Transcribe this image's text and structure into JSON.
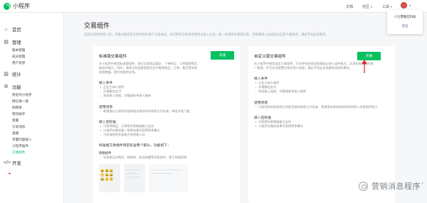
{
  "app": {
    "title": "小程序"
  },
  "topbar": {
    "links": [
      "文档",
      "社区",
      "工具"
    ],
    "account_name": "八九零微信科技",
    "logout_label": "退出"
  },
  "sidebar": {
    "groups": [
      {
        "icon": "home-icon",
        "label": "首页",
        "items": []
      },
      {
        "icon": "manage-icon",
        "label": "管理",
        "items": [
          "版本管理",
          "成员管理",
          "用户反馈"
        ]
      },
      {
        "icon": "stats-icon",
        "label": "统计",
        "items": []
      },
      {
        "icon": "feature-icon",
        "label": "功能",
        "items": [
          "附近的小程序",
          "微信搜一搜",
          "购物单",
          "物流助手",
          "客服",
          "订阅消息",
          "直播",
          "页面内容接入",
          "小程序插件",
          "交易组件"
        ]
      },
      {
        "icon": "dev-icon",
        "label": "开发",
        "items": []
      }
    ]
  },
  "main": {
    "title": "交易组件",
    "description": "当前交易组件接入后，可通过微信官方组件提升用户交易体验，也可参考交易组件使用与接入方式，统一的组件化管理方案，可按需接入标准版与自定义版组件，满足不同业务需求。"
  },
  "cards": {
    "standard": {
      "title": "标准版交易组件",
      "open_label": "开通",
      "description": "在小程序中使用标准版组件，即可实现商品展示、下单购买、订单管理等功能闭环能力，同时，商家可在配套管理后台中管理商品、订单、售后等交易流程数据，提升交易转化率。",
      "sections": [
        {
          "title": "接入条件",
          "items": [
            "企业主体小程序",
            "开通微信支付",
            "完成接入流程，详情请参考接入指南"
          ]
        },
        {
          "title": "适用场景",
          "items": [
            "希望通过小程序实现快速交易闭环的商家与开发者，降低开发门槛"
          ]
        },
        {
          "title": "接入后权益",
          "items": [
            "可获得商品、订单等交易数据能力支持",
            "小程序在微信搜一搜等场景可获得更多曝光",
            "可申请相关交易能力的快速入口"
          ]
        },
        {
          "title": "标准版交易组件目前包含两个部分，功能如下：",
          "items": []
        },
        {
          "title": "购物组件",
          "items": [
            "包括商品详情页、购物车、商品结算等页面组件，便于快速搭建"
          ]
        }
      ],
      "emoji_rows": [
        "😀😃😄",
        "😁😆😅",
        "😂🙂🙃"
      ]
    },
    "custom": {
      "title": "自定义版交易组件",
      "open_label": "开通",
      "description": "在小程序中使用自定义版组件，可在原有交易流程基础上接入组件能力，实现交易数据的统一管理，并可灵活配置交易页面与流程，满足不同业务场景的定制化需求。",
      "sections": [
        {
          "title": "接入条件",
          "items": [
            "企业主体小程序",
            "开通微信支付",
            "完成接入流程，详情请参考接入指南"
          ]
        },
        {
          "title": "适用场景",
          "items": [
            "已有成熟交易流程与交易页面的商家与开发者，希望保持原有体验的同时接入交易组件能力"
          ]
        },
        {
          "title": "接入后权益",
          "items": [
            "可获得交易数据能力支持",
            "小程序在微信场景可获得更多曝光"
          ]
        }
      ]
    }
  },
  "watermark": {
    "text": "营销消息程序"
  },
  "colors": {
    "accent": "#07c160",
    "link": "#576b95",
    "marker": "#e02020"
  }
}
